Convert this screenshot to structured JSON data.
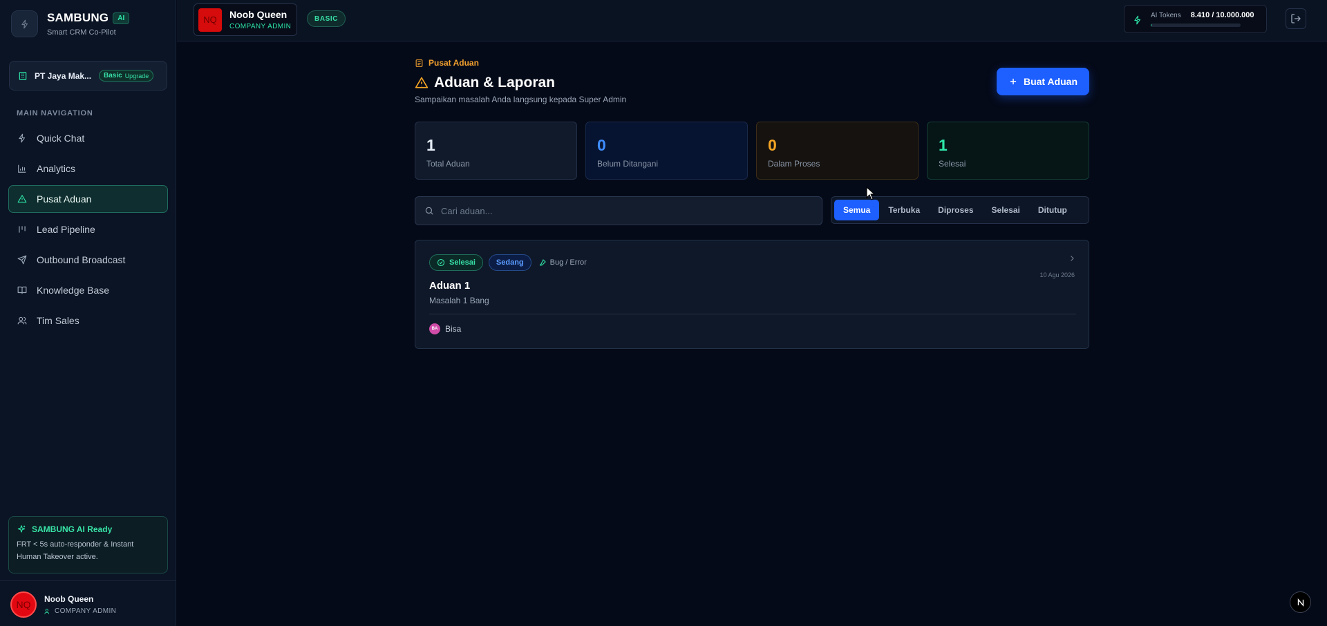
{
  "brand": {
    "name": "SAMBUNG",
    "ai_badge": "AI",
    "subtitle": "Smart CRM Co-Pilot"
  },
  "company": {
    "name": "PT Jaya Mak...",
    "plan": "Basic",
    "upgrade": "Upgrade"
  },
  "nav": {
    "section_title": "MAIN NAVIGATION",
    "items": [
      {
        "label": "Quick Chat",
        "icon": "bolt-icon"
      },
      {
        "label": "Analytics",
        "icon": "bar-chart-icon"
      },
      {
        "label": "Pusat Aduan",
        "icon": "warning-icon",
        "active": true
      },
      {
        "label": "Lead Pipeline",
        "icon": "pipeline-icon"
      },
      {
        "label": "Outbound Broadcast",
        "icon": "send-icon"
      },
      {
        "label": "Knowledge Base",
        "icon": "book-icon"
      },
      {
        "label": "Tim Sales",
        "icon": "users-icon"
      }
    ]
  },
  "ai_status": {
    "title": "SAMBUNG AI Ready",
    "body": "FRT < 5s auto-responder & Instant Human Takeover active."
  },
  "sidebar_user": {
    "initials": "NQ",
    "name": "Noob Queen",
    "role": "COMPANY ADMIN"
  },
  "topbar": {
    "user_initials": "NQ",
    "user_name": "Noob Queen",
    "user_role": "COMPANY ADMIN",
    "plan_badge": "BASIC",
    "tokens_label": "AI Tokens",
    "tokens_value": "8.410 / 10.000.000",
    "tokens_used_fraction": 0.00084
  },
  "page": {
    "breadcrumb": "Pusat Aduan",
    "title": "Aduan & Laporan",
    "subtitle": "Sampaikan masalah Anda langsung kepada Super Admin",
    "create_button": "Buat Aduan"
  },
  "stats": [
    {
      "value": "1",
      "label": "Total Aduan"
    },
    {
      "value": "0",
      "label": "Belum Ditangani"
    },
    {
      "value": "0",
      "label": "Dalam Proses"
    },
    {
      "value": "1",
      "label": "Selesai"
    }
  ],
  "search": {
    "placeholder": "Cari aduan...",
    "value": ""
  },
  "filters": {
    "tabs": [
      "Semua",
      "Terbuka",
      "Diproses",
      "Selesai",
      "Ditutup"
    ],
    "active": "Semua"
  },
  "tickets": [
    {
      "status": "Selesai",
      "priority": "Sedang",
      "category": "Bug / Error",
      "date": "10 Agu 2026",
      "title": "Aduan 1",
      "description": "Masalah 1 Bang",
      "author_initials": "BA",
      "author": "Bisa"
    }
  ],
  "colors": {
    "accent_green": "#2ee6a8",
    "primary_blue": "#1d5fff",
    "warning_orange": "#f5a524",
    "background": "#050a18"
  }
}
